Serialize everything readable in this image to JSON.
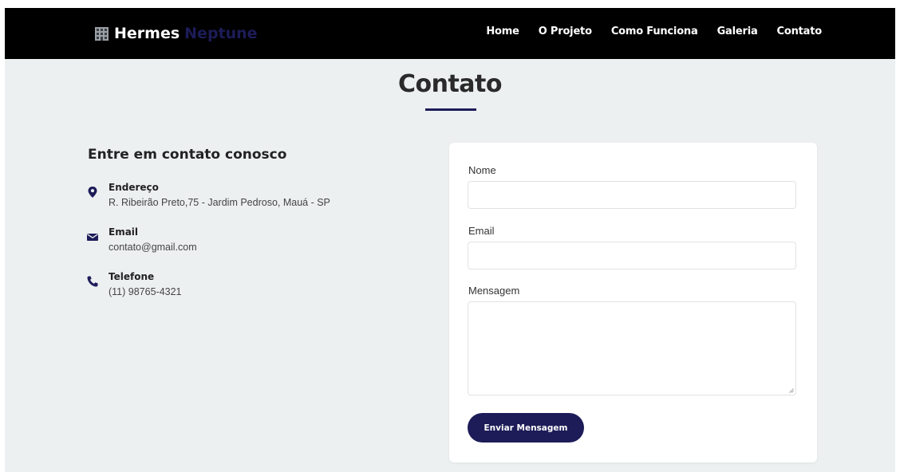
{
  "brand": {
    "name_part1": "Hermes",
    "name_part2": "Neptune",
    "logo_icon": "building-icon"
  },
  "nav": {
    "items": [
      "Home",
      "O Projeto",
      "Como Funciona",
      "Galeria",
      "Contato"
    ]
  },
  "page": {
    "title": "Contato"
  },
  "contact_info": {
    "heading": "Entre em contato conosco",
    "items": [
      {
        "icon": "map-marker-icon",
        "label": "Endereço",
        "value": "R. Ribeirão Preto,75 - Jardim Pedroso, Mauá - SP"
      },
      {
        "icon": "envelope-icon",
        "label": "Email",
        "value": "contato@gmail.com"
      },
      {
        "icon": "phone-icon",
        "label": "Telefone",
        "value": "(11) 98765-4321"
      }
    ]
  },
  "form": {
    "name_label": "Nome",
    "name_value": "",
    "email_label": "Email",
    "email_value": "",
    "message_label": "Mensagem",
    "message_value": "",
    "submit_label": "Enviar Mensagem"
  },
  "colors": {
    "navbar": "#000000",
    "accent": "#1d1c58",
    "background": "#edf0f1",
    "card": "#ffffff"
  }
}
